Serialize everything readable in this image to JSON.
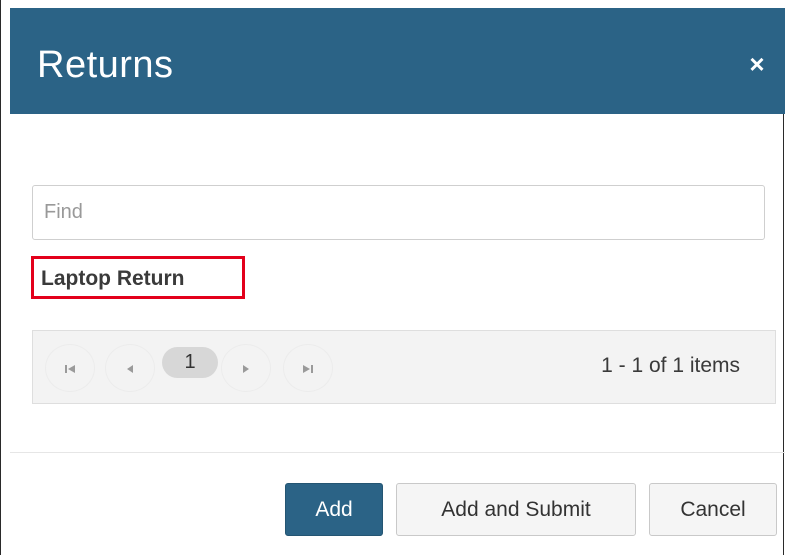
{
  "dialog": {
    "title": "Returns",
    "close_icon": "close-icon",
    "close_glyph": "×"
  },
  "search": {
    "placeholder": "Find",
    "value": ""
  },
  "results": {
    "items": [
      {
        "label": "Laptop Return",
        "highlighted": true
      }
    ]
  },
  "pager": {
    "first_icon": "first-page-icon",
    "first_glyph": "⏮",
    "prev_icon": "previous-page-icon",
    "prev_glyph": "◀",
    "current_page": "1",
    "next_icon": "next-page-icon",
    "next_glyph": "▶",
    "last_icon": "last-page-icon",
    "last_glyph": "⏭",
    "info": "1 - 1 of 1 items"
  },
  "footer": {
    "add_label": "Add",
    "add_submit_label": "Add and Submit",
    "cancel_label": "Cancel"
  },
  "colors": {
    "header_bg": "#2b6386",
    "primary_button": "#2b6386",
    "highlight_border": "#e3001b"
  }
}
